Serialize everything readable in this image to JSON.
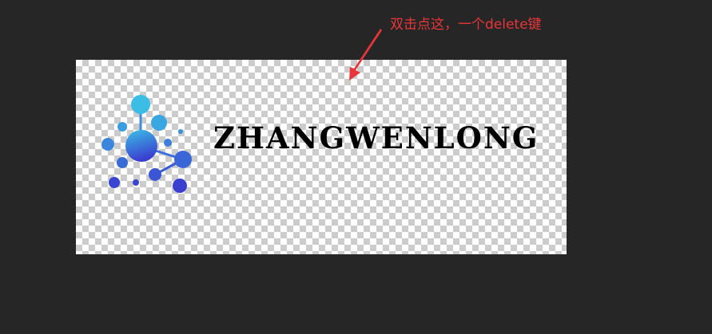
{
  "annotation": {
    "text": "双击点这，一个delete键",
    "color": "#e8353a"
  },
  "logo": {
    "wordmark": "ZHANGWENLONG",
    "mark": "molecule-network-icon",
    "gradient": [
      "#3bc0e6",
      "#3a3fd0"
    ]
  },
  "canvas": {
    "background": "transparency-checkerboard"
  }
}
